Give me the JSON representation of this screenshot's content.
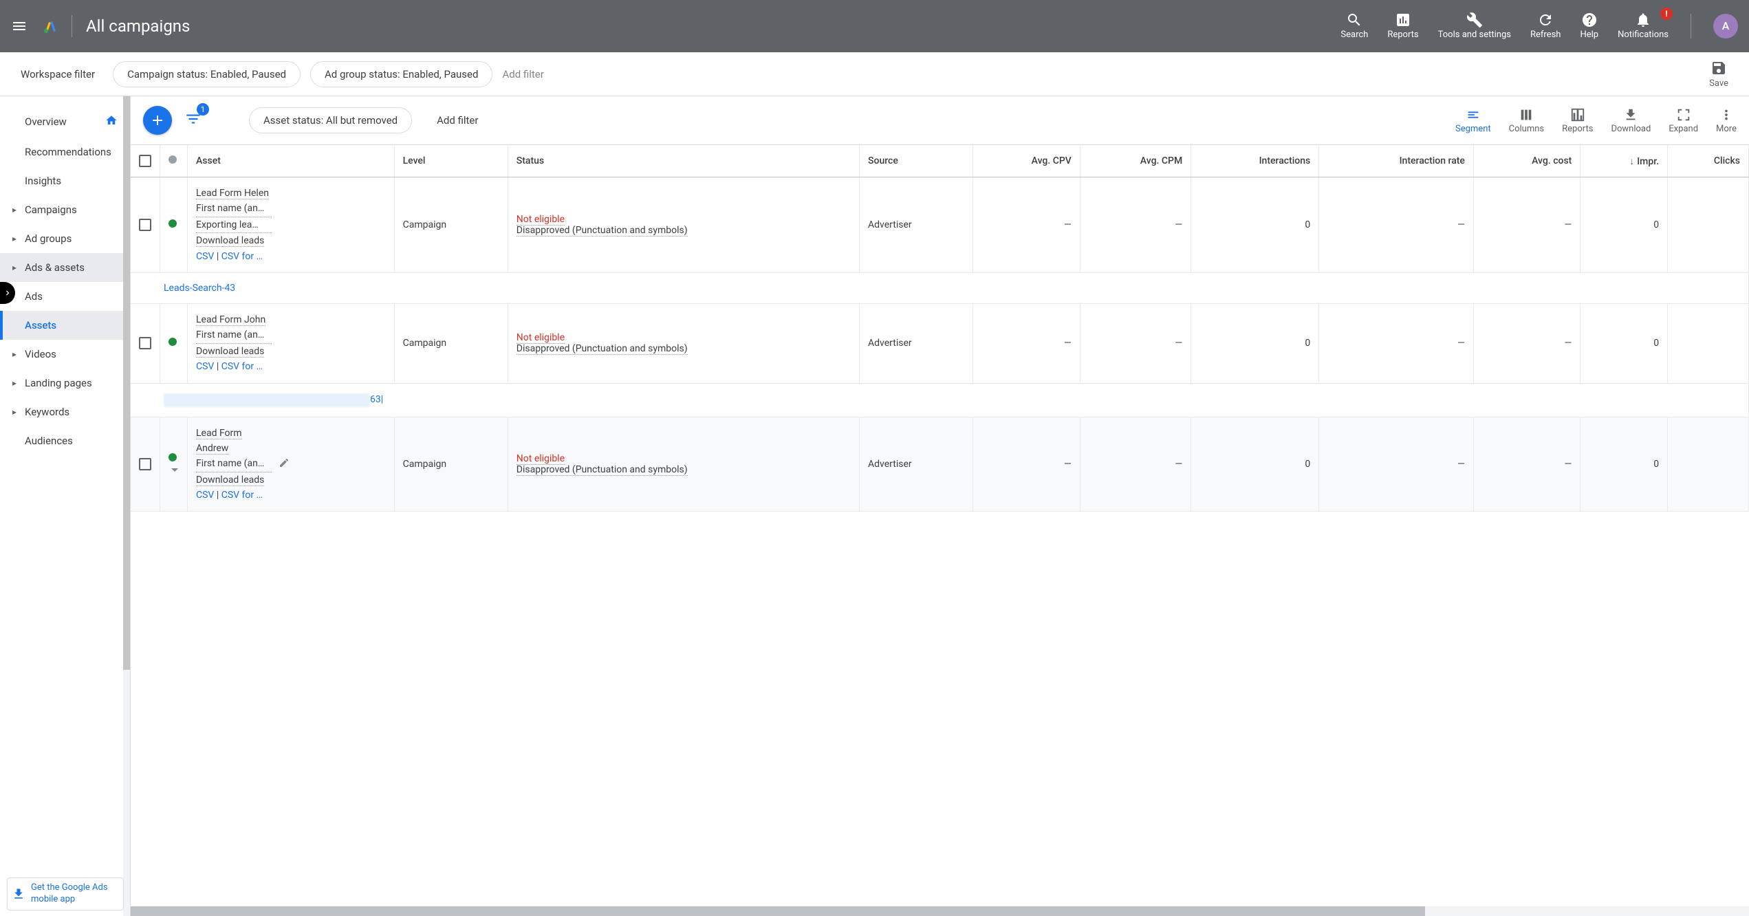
{
  "header": {
    "title": "All campaigns",
    "nav": [
      {
        "key": "search",
        "label": "Search"
      },
      {
        "key": "reports",
        "label": "Reports"
      },
      {
        "key": "tools",
        "label": "Tools and settings"
      },
      {
        "key": "refresh",
        "label": "Refresh"
      },
      {
        "key": "help",
        "label": "Help"
      },
      {
        "key": "notifications",
        "label": "Notifications"
      }
    ],
    "notif_badge": "!",
    "avatar_initial": "A"
  },
  "filterbar": {
    "workspace_label": "Workspace filter",
    "chips": [
      "Campaign status: Enabled, Paused",
      "Ad group status: Enabled, Paused"
    ],
    "add_filter": "Add filter",
    "save": "Save"
  },
  "sidebar": {
    "items": [
      {
        "label": "Overview",
        "home": true
      },
      {
        "label": "Recommendations"
      },
      {
        "label": "Insights"
      },
      {
        "label": "Campaigns",
        "arrow": true
      },
      {
        "label": "Ad groups",
        "arrow": true
      },
      {
        "label": "Ads & assets",
        "arrow": true,
        "parent_active": true
      },
      {
        "label": "Ads",
        "sub": true
      },
      {
        "label": "Assets",
        "sub": true,
        "active": true
      },
      {
        "label": "Videos",
        "arrow": true
      },
      {
        "label": "Landing pages",
        "arrow": true
      },
      {
        "label": "Keywords",
        "arrow": true
      },
      {
        "label": "Audiences"
      }
    ],
    "mobile_promo": "Get the Google Ads mobile app"
  },
  "toolbar": {
    "filter_count": "1",
    "asset_status_chip": "Asset status: All but removed",
    "add_filter": "Add filter",
    "right": [
      {
        "key": "segment",
        "label": "Segment",
        "active": true
      },
      {
        "key": "columns",
        "label": "Columns"
      },
      {
        "key": "reports2",
        "label": "Reports"
      },
      {
        "key": "download",
        "label": "Download"
      },
      {
        "key": "expand",
        "label": "Expand"
      },
      {
        "key": "more",
        "label": "More"
      }
    ]
  },
  "table": {
    "headers": [
      "",
      "",
      "Asset",
      "Level",
      "Status",
      "Source",
      "Avg. CPV",
      "Avg. CPM",
      "Interactions",
      "Interaction rate",
      "Avg. cost",
      "Impr.",
      "Clicks"
    ],
    "sort_col": "Impr.",
    "rows": [
      {
        "asset_title": "Lead Form Helen",
        "asset_sub": "First name (an…",
        "asset_note": "Exporting lea…",
        "download_leads": "Download leads",
        "csv": "CSV",
        "csv_for": "CSV for …",
        "level": "Campaign",
        "status_primary": "Not eligible",
        "status_secondary": "Disapproved (Punctuation and symbols)",
        "source": "Advertiser",
        "avg_cpv": "—",
        "avg_cpm": "—",
        "interactions": "0",
        "interaction_rate": "—",
        "avg_cost": "—",
        "impr": "0"
      },
      {
        "type": "group",
        "label": "Leads-Search-43"
      },
      {
        "asset_title": "Lead Form John",
        "asset_sub": "First name (an…",
        "download_leads": "Download leads",
        "csv": "CSV",
        "csv_for": "CSV for …",
        "level": "Campaign",
        "status_primary": "Not eligible",
        "status_secondary": "Disapproved (Punctuation and symbols)",
        "source": "Advertiser",
        "avg_cpv": "—",
        "avg_cpm": "—",
        "interactions": "0",
        "interaction_rate": "—",
        "avg_cost": "—",
        "impr": "0"
      },
      {
        "type": "group",
        "label": "63|",
        "blurred": true
      },
      {
        "asset_title": "Lead Form Andrew",
        "asset_sub": "First name (an…",
        "download_leads": "Download leads",
        "csv": "CSV",
        "csv_for": "CSV for …",
        "level": "Campaign",
        "status_primary": "Not eligible",
        "status_secondary": "Disapproved (Punctuation and symbols)",
        "source": "Advertiser",
        "avg_cpv": "—",
        "avg_cpm": "—",
        "interactions": "0",
        "interaction_rate": "—",
        "avg_cost": "—",
        "impr": "0",
        "hovered": true,
        "caret": true,
        "edit": true
      }
    ]
  }
}
